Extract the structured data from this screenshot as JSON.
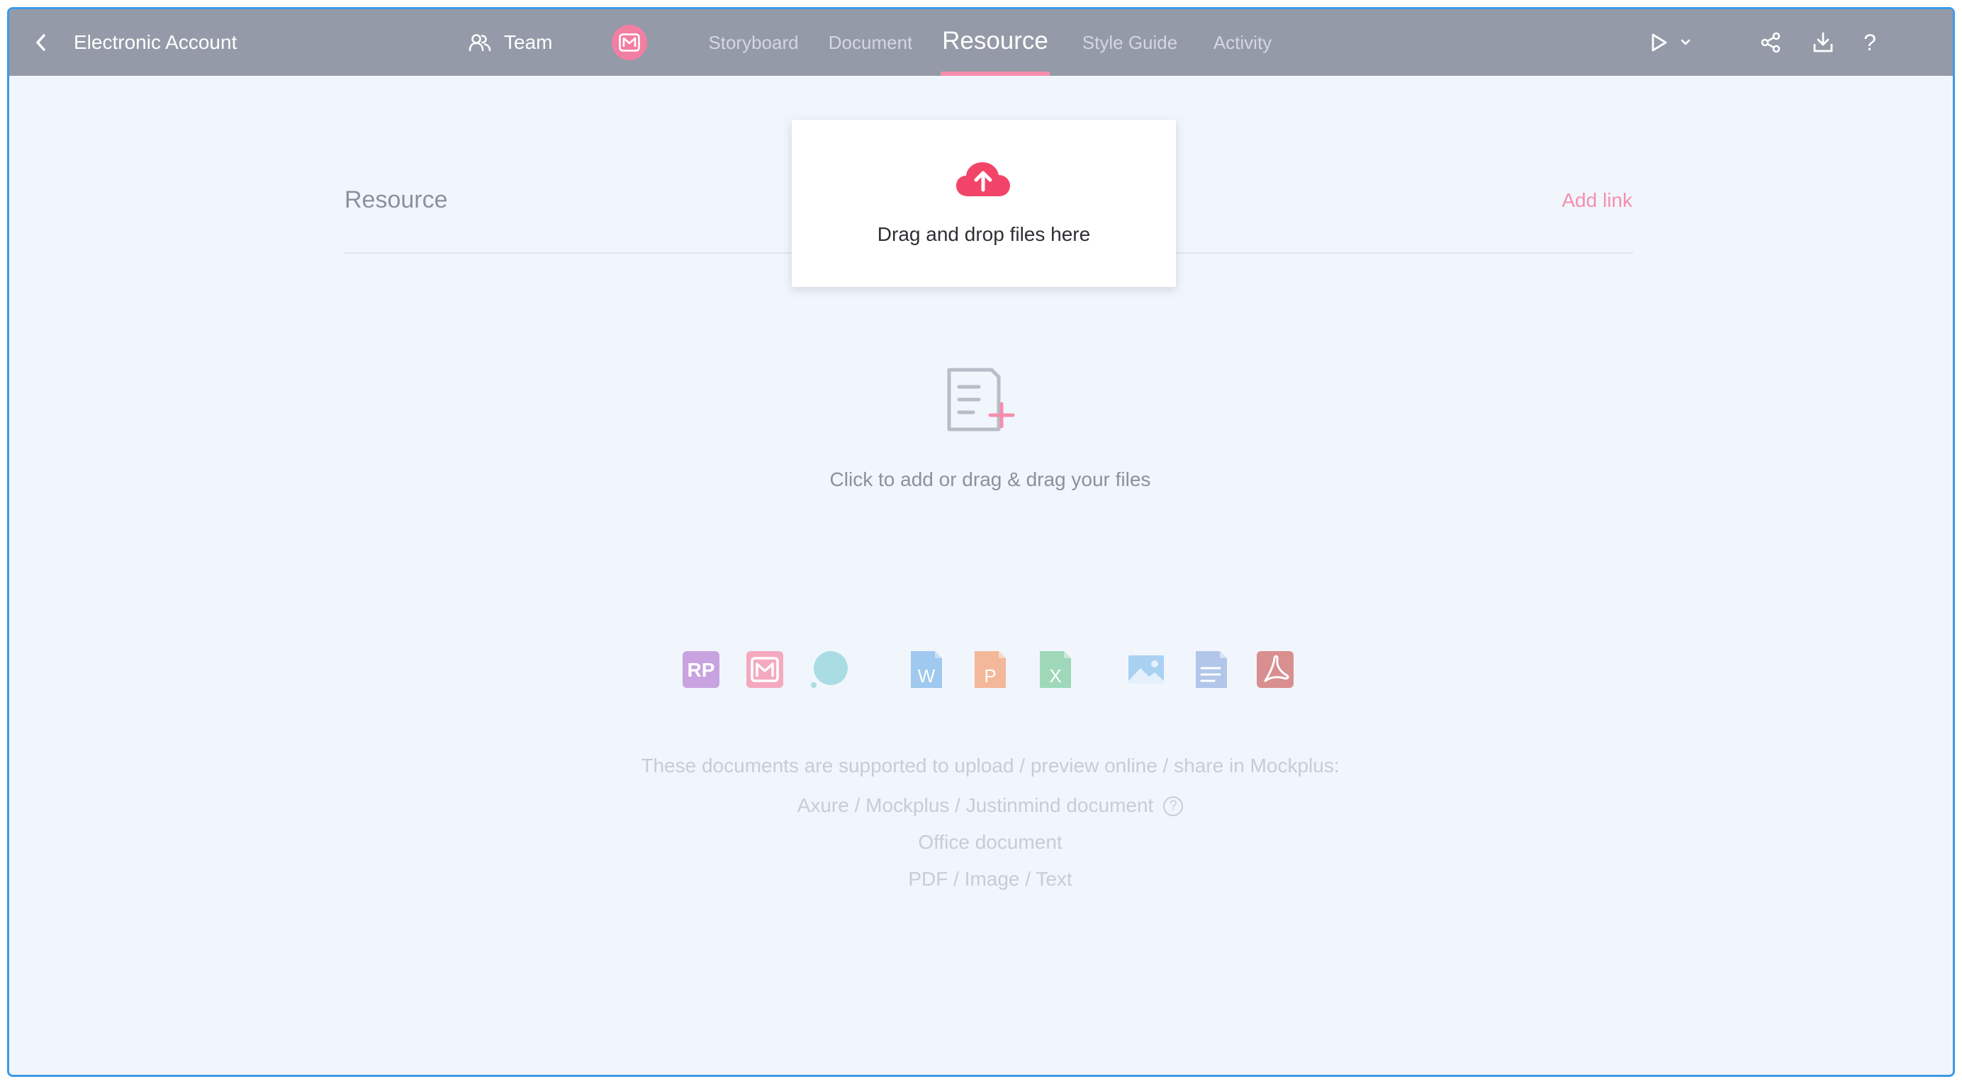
{
  "header": {
    "app_title": "Electronic Account",
    "team_label": "Team",
    "tabs": [
      {
        "label": "Storyboard",
        "active": false
      },
      {
        "label": "Document",
        "active": false
      },
      {
        "label": "Resource",
        "active": true
      },
      {
        "label": "Style Guide",
        "active": false
      },
      {
        "label": "Activity",
        "active": false
      }
    ],
    "help_label": "?"
  },
  "content": {
    "section_title": "Resource",
    "add_link_label": "Add link",
    "drop_zone_text": "Drag and drop files here",
    "empty_state_text": "Click to add or drag & drag your files",
    "formats": {
      "rp": "RP",
      "word": "W",
      "ppt": "P",
      "excel": "X"
    },
    "support": {
      "intro": "These documents are supported to upload / preview online / share in Mockplus:",
      "line1": "Axure / Mockplus / Justinmind document",
      "help": "?",
      "line2": "Office document",
      "line3": "PDF / Image / Text"
    }
  },
  "colors": {
    "topbar": "#959aa8",
    "accent_pink": "#f58fac",
    "upload_red": "#f24468",
    "background": "#f1f6fd",
    "frame_border": "#3d9ae8"
  }
}
